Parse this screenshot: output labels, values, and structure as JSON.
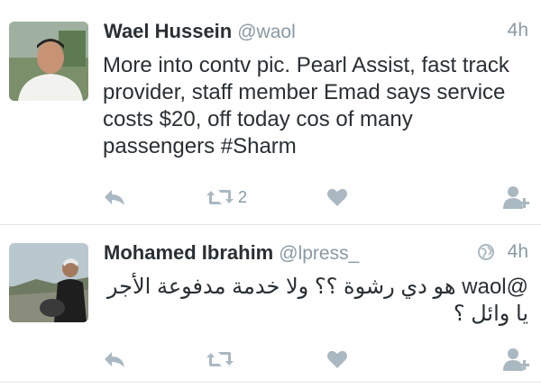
{
  "tweets": [
    {
      "name": "Wael Hussein",
      "handle": "@waol",
      "time": "4h",
      "text": "More into contv pic. Pearl Assist, fast track provider, staff member Emad says service costs $20, off today cos of many passengers #Sharm",
      "retweet_count": "2"
    },
    {
      "name": "Mohamed Ibrahim",
      "handle": "@lpress_",
      "time": "4h",
      "text": "@waol هو دي رشوة ؟؟ ولا خدمة مدفوعة الأجر يا وائل ؟",
      "retweet_count": ""
    }
  ],
  "icons": [
    "reply-icon",
    "retweet-icon",
    "like-icon",
    "follow-icon",
    "globe-icon"
  ],
  "colors": {
    "icon_gray": "#aab8c2",
    "secondary_text": "#8899a6",
    "primary_text": "#292f33"
  }
}
